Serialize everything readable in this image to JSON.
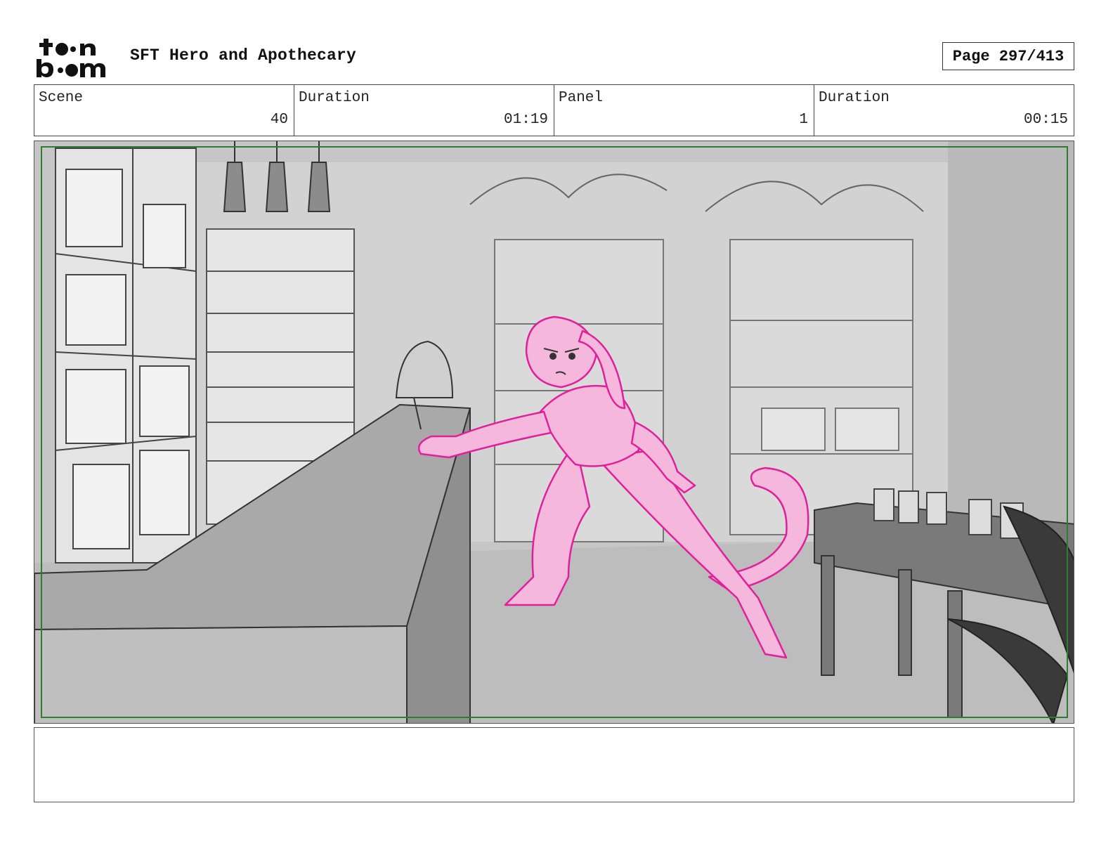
{
  "header": {
    "logo_text_line1": "toon",
    "logo_text_line2": "boom",
    "project_title": "SFT Hero and Apothecary",
    "page_label": "Page 297/413"
  },
  "info": {
    "scene_label": "Scene",
    "scene_value": "40",
    "scene_duration_label": "Duration",
    "scene_duration_value": "01:19",
    "panel_label": "Panel",
    "panel_value": "1",
    "panel_duration_label": "Duration",
    "panel_duration_value": "00:15"
  },
  "panel": {
    "safe_area_color": "#2e7d32",
    "character_color": "#f5b8dc",
    "character_line_color": "#e0209a",
    "background_color": "#c9c9c9"
  },
  "notes": {
    "text": ""
  }
}
